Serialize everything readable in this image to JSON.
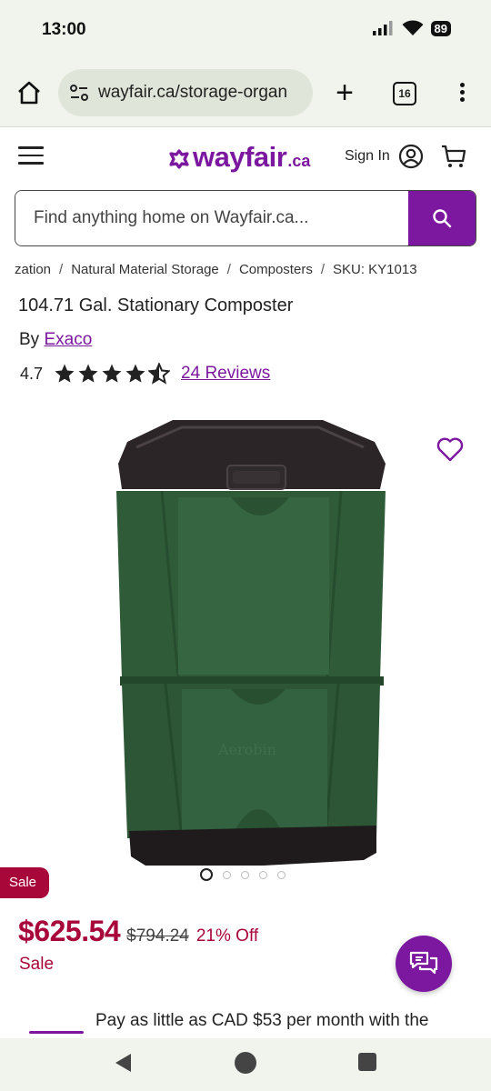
{
  "status": {
    "time": "13:00",
    "battery": "89"
  },
  "browser": {
    "url": "wayfair.ca/storage-organ",
    "tab_count": "16",
    "new_tab": "+"
  },
  "header": {
    "logo_word": "wayfair",
    "logo_suffix": ".ca",
    "sign_in": "Sign In"
  },
  "search": {
    "placeholder": "Find anything home on Wayfair.ca..."
  },
  "breadcrumb": [
    "zation",
    "Natural Material Storage",
    "Composters",
    "SKU: KY1013"
  ],
  "product": {
    "title": "104.71 Gal. Stationary Composter",
    "by_label": "By",
    "brand": "Exaco",
    "rating": "4.7",
    "rating_value": 4.7,
    "rating_max": 5,
    "reviews": "24 Reviews",
    "image_count": 5,
    "image_index": 1,
    "sale_badge": "Sale",
    "price": "$625.54",
    "old_price": "$794.24",
    "discount": "21% Off",
    "sale_label": "Sale",
    "finance_text": "Pay as little as CAD $53 per month with the"
  },
  "colors": {
    "brand": "#7b189f",
    "sale": "#a8073a",
    "composter_green": "#2f5b38",
    "composter_lid": "#2b2527"
  },
  "icons": [
    "home-icon",
    "site-settings-icon",
    "plus-icon",
    "tabs-icon",
    "overflow-menu-icon",
    "hamburger-icon",
    "account-icon",
    "cart-icon",
    "search-icon",
    "star-icon",
    "heart-icon",
    "chat-icon",
    "back-icon",
    "home-nav-icon",
    "recents-icon"
  ]
}
